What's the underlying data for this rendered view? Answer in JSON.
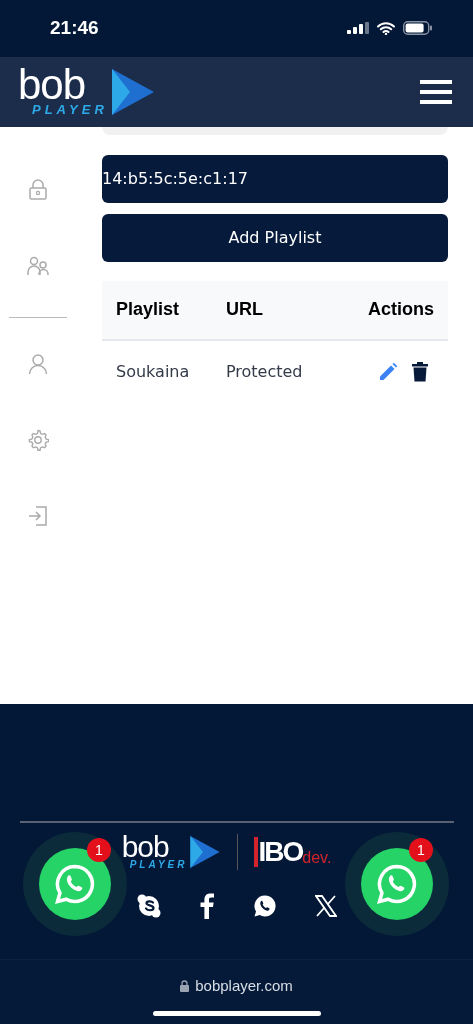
{
  "status_bar": {
    "time": "21:46"
  },
  "header": {
    "logo": {
      "word": "bob",
      "sub": "PLAYER"
    }
  },
  "sidebar": {
    "items": [
      {
        "kind": "lock"
      },
      {
        "kind": "users"
      },
      {
        "kind": "divider"
      },
      {
        "kind": "user"
      },
      {
        "kind": "gear"
      },
      {
        "kind": "logout"
      }
    ]
  },
  "mac_field": {
    "value": "14:b5:5c:5e:c1:17"
  },
  "add_button": {
    "label": "Add Playlist"
  },
  "table": {
    "columns": [
      "Playlist",
      "URL",
      "Actions"
    ],
    "rows": [
      {
        "playlist": "Soukaina",
        "url": "Protected"
      }
    ]
  },
  "footer": {
    "logo": {
      "word": "bob",
      "sub": "PLAYER"
    },
    "partner_logo": {
      "mark": "IBO",
      "suffix": "dev."
    },
    "social": [
      {
        "kind": "skype"
      },
      {
        "kind": "facebook"
      },
      {
        "kind": "whatsapp"
      },
      {
        "kind": "x"
      }
    ]
  },
  "floating_buttons": [
    {
      "badge": "1"
    },
    {
      "badge": "1"
    }
  ],
  "browser_bar": {
    "url": "bobplayer.com"
  }
}
